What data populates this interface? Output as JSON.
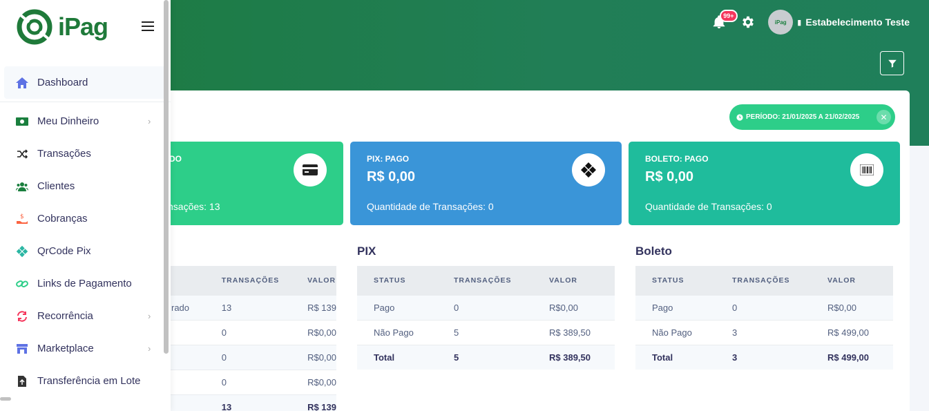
{
  "brand": "iPag",
  "topbar": {
    "notifications": "99+",
    "avatar_text": "iPag",
    "user": "Estabelecimento Teste"
  },
  "period": "PERÍODO: 21/01/2025 A 21/02/2025",
  "stats": [
    {
      "title": "DO",
      "value": "",
      "qty": "nsações: 13",
      "color": "#2dce89"
    },
    {
      "title": "PIX: PAGO",
      "value": "R$ 0,00",
      "qty": "Quantidade de Transações: 0",
      "color": "#3a95d8"
    },
    {
      "title": "BOLETO: PAGO",
      "value": "R$ 0,00",
      "qty": "Quantidade de Transações: 0",
      "color": "#1fbc9c"
    }
  ],
  "tables": {
    "card": {
      "headers": [
        "",
        "TRANSAÇÕES",
        "VALOR"
      ],
      "rows": [
        [
          "rado",
          "13",
          "R$ 139"
        ],
        [
          "",
          "0",
          "R$0,00"
        ],
        [
          "",
          "0",
          "R$0,00"
        ],
        [
          "",
          "0",
          "R$0,00"
        ],
        [
          "",
          "13",
          "R$ 139"
        ]
      ]
    },
    "pix": {
      "title": "PIX",
      "headers": [
        "STATUS",
        "TRANSAÇÕES",
        "VALOR"
      ],
      "rows": [
        [
          "Pago",
          "0",
          "R$0,00"
        ],
        [
          "Não Pago",
          "5",
          "R$ 389,50"
        ],
        [
          "Total",
          "5",
          "R$ 389,50"
        ]
      ]
    },
    "boleto": {
      "title": "Boleto",
      "headers": [
        "STATUS",
        "TRANSAÇÕES",
        "VALOR"
      ],
      "rows": [
        [
          "Pago",
          "0",
          "R$0,00"
        ],
        [
          "Não Pago",
          "3",
          "R$ 499,00"
        ],
        [
          "Total",
          "3",
          "R$ 499,00"
        ]
      ]
    }
  },
  "nav": [
    {
      "label": "Dashboard",
      "icon": "home-icon",
      "color": "#5e72e4",
      "active": true,
      "chevron": false
    },
    {
      "label": "Meu Dinheiro",
      "icon": "money-icon",
      "color": "#1a7f3e",
      "chevron": true
    },
    {
      "label": "Transações",
      "icon": "shuffle-icon",
      "color": "#222",
      "chevron": false
    },
    {
      "label": "Clientes",
      "icon": "users-icon",
      "color": "#1a7f3e",
      "chevron": false
    },
    {
      "label": "Cobranças",
      "icon": "hand-coin-icon",
      "color": "#fb6340",
      "chevron": false
    },
    {
      "label": "QrCode Pix",
      "icon": "pix-icon",
      "color": "#2bb6a3",
      "chevron": false
    },
    {
      "label": "Links de Pagamento",
      "icon": "link-icon",
      "color": "#2dce89",
      "chevron": false
    },
    {
      "label": "Recorrência",
      "icon": "sync-icon",
      "color": "#f5365c",
      "chevron": true
    },
    {
      "label": "Marketplace",
      "icon": "store-icon",
      "color": "#5e72e4",
      "chevron": true
    },
    {
      "label": "Transferência em Lote",
      "icon": "file-upload-icon",
      "color": "#333",
      "chevron": false
    }
  ]
}
